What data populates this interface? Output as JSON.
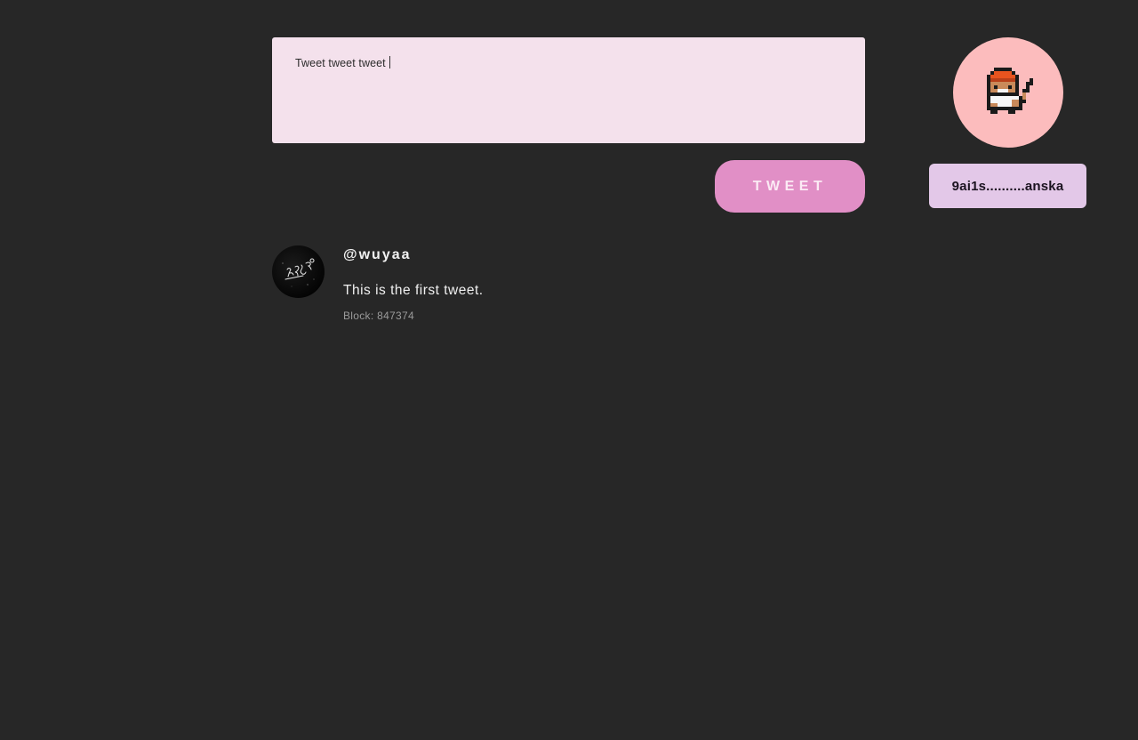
{
  "composer": {
    "value": "Tweet tweet tweet "
  },
  "actions": {
    "tweet_label": "TWEET"
  },
  "profile": {
    "avatar_icon": "pixel-cat-avatar-icon",
    "avatar_bg": "#fcbcbd",
    "wallet_address": "9ai1s..........anska"
  },
  "feed": [
    {
      "handle": "@wuyaa",
      "text": "This is the first tweet.",
      "block": "Block: 847374"
    }
  ],
  "colors": {
    "background": "#272727",
    "composer_bg": "#f4e1ec",
    "tweet_button": "#e18fc6",
    "wallet_button": "#e3c8e8"
  }
}
